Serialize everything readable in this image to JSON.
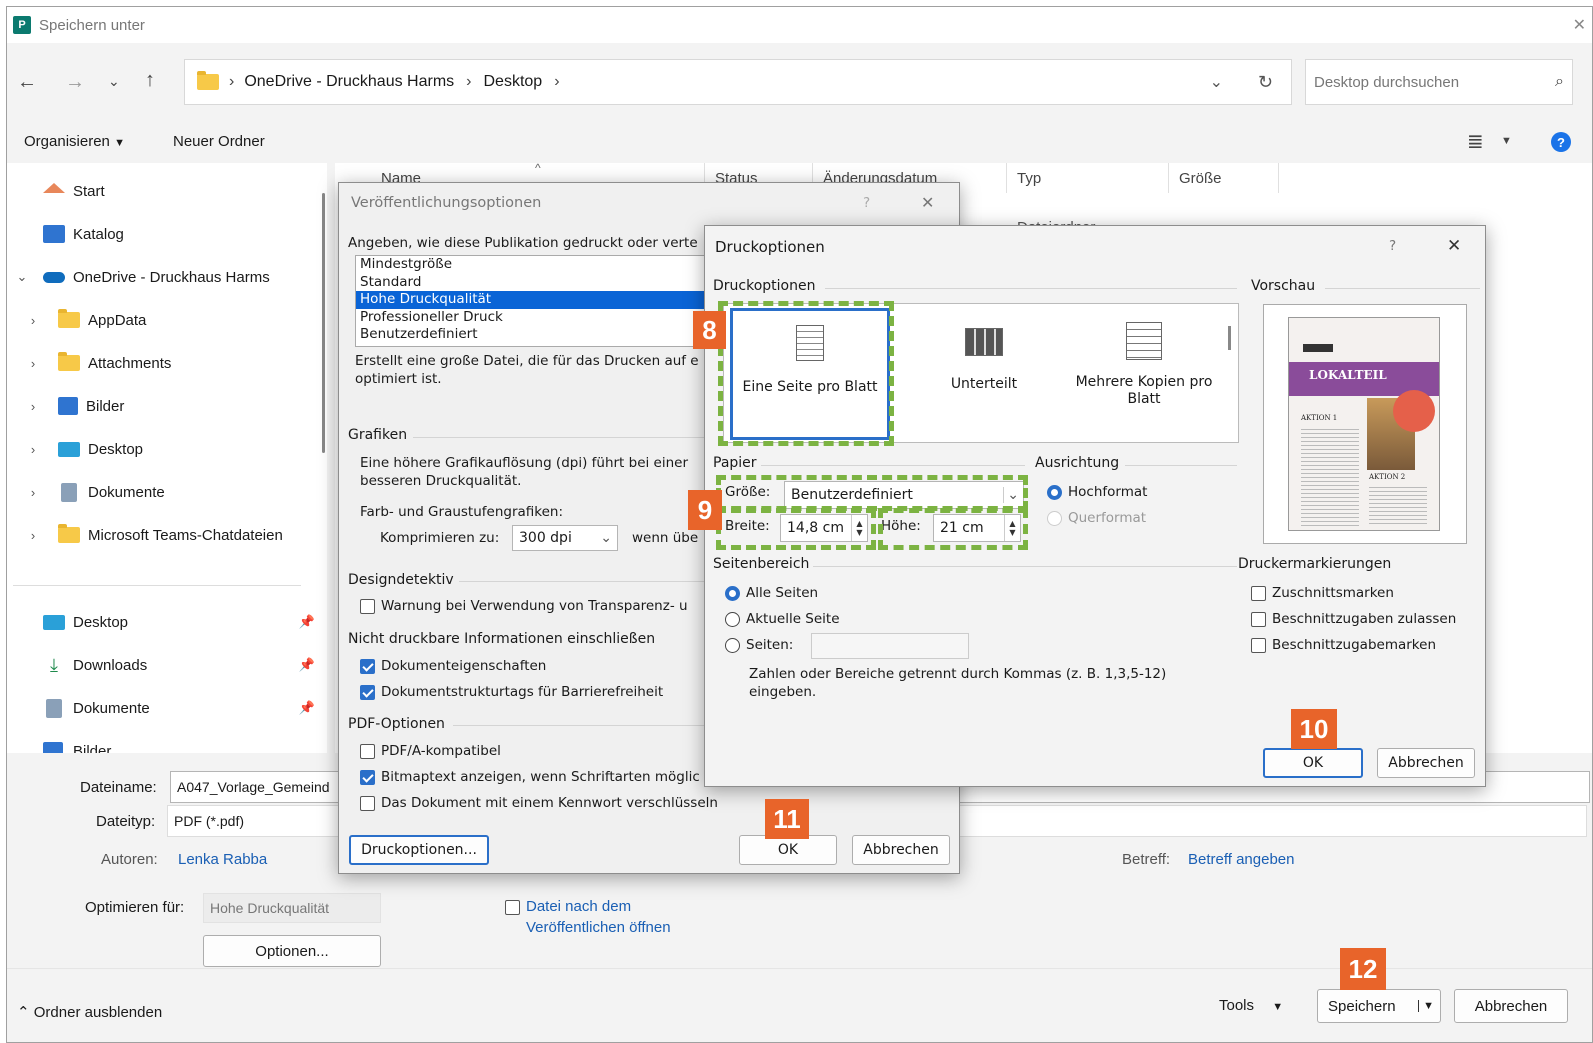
{
  "window": {
    "title": "Speichern unter"
  },
  "address": {
    "path": [
      "OneDrive - Druckhaus Harms",
      "Desktop"
    ],
    "search_placeholder": "Desktop durchsuchen"
  },
  "toolbar": {
    "organize": "Organisieren",
    "new_folder": "Neuer Ordner"
  },
  "nav": {
    "start": "Start",
    "katalog": "Katalog",
    "onedrive": "OneDrive - Druckhaus Harms",
    "folders": [
      "AppData",
      "Attachments",
      "Bilder",
      "Desktop",
      "Dokumente",
      "Microsoft Teams-Chatdateien"
    ],
    "quick": [
      "Desktop",
      "Downloads",
      "Dokumente",
      "Bilder"
    ]
  },
  "columns": {
    "name": "Name",
    "status": "Status",
    "date": "Änderungsdatum",
    "type": "Typ",
    "size": "Größe",
    "first_row_type": "Dateiordner"
  },
  "form": {
    "filename_label": "Dateiname:",
    "filename": "A047_Vorlage_Gemeind",
    "filetype_label": "Dateityp:",
    "filetype": "PDF (*.pdf)",
    "authors_label": "Autoren:",
    "authors": "Lenka Rabba",
    "subject_label": "Betreff:",
    "subject": "Betreff angeben",
    "optimize_label": "Optimieren für:",
    "optimize": "Hohe Druckqualität",
    "open_after_1": "Datei nach dem",
    "open_after_2": "Veröffentlichen öffnen",
    "options": "Optionen..."
  },
  "footer": {
    "hide_folders": "Ordner ausblenden",
    "tools": "Tools",
    "save": "Speichern",
    "cancel": "Abbrechen"
  },
  "publish": {
    "title": "Veröffentlichungsoptionen",
    "question": "?",
    "prompt": "Angeben, wie diese Publikation gedruckt oder verte",
    "list": [
      "Mindestgröße",
      "Standard",
      "Hohe Druckqualität",
      "Professioneller Druck",
      "Benutzerdefiniert"
    ],
    "desc1": "Erstellt eine große Datei, die für das Drucken auf e",
    "desc2": "optimiert ist.",
    "graphics": "Grafiken",
    "graphics_desc1": "Eine höhere Grafikauflösung (dpi) führt bei einer",
    "graphics_desc2": "besseren Druckqualität.",
    "color_label": "Farb- und Graustufengrafiken:",
    "compress_label": "Komprimieren zu:",
    "compress": "300 dpi",
    "when": "wenn übe",
    "design": "Designdetektiv",
    "warn": "Warnung bei Verwendung von Transparenz- u",
    "nonprint": "Nicht druckbare Informationen einschließen",
    "docprops": "Dokumenteigenschaften",
    "doctags": "Dokumentstrukturtags für Barrierefreiheit",
    "pdf": "PDF-Optionen",
    "pdfa": "PDF/A-kompatibel",
    "bitmap": "Bitmaptext anzeigen, wenn Schriftarten möglic",
    "encrypt": "Das Dokument mit einem Kennwort verschlüsseln",
    "printopts": "Druckoptionen...",
    "ok": "OK",
    "cancel": "Abbrechen"
  },
  "print": {
    "title": "Druckoptionen",
    "question": "?",
    "section": "Druckoptionen",
    "layouts": [
      "Eine Seite pro Blatt",
      "Unterteilt",
      "Mehrere Kopien pro Blatt"
    ],
    "preview": "Vorschau",
    "paper": "Papier",
    "size_label": "Größe:",
    "size": "Benutzerdefiniert",
    "width_label": "Breite:",
    "width": "14,8 cm",
    "height_label": "Höhe:",
    "height": "21 cm",
    "orientation": "Ausrichtung",
    "portrait": "Hochformat",
    "landscape": "Querformat",
    "range": "Seitenbereich",
    "all": "Alle Seiten",
    "current": "Aktuelle Seite",
    "pages": "Seiten:",
    "hint1": "Zahlen oder Bereiche getrennt durch Kommas (z. B. 1,3,5-12)",
    "hint2": "eingeben.",
    "marks": "Druckermarkierungen",
    "crop": "Zuschnittsmarken",
    "bleed": "Beschnittzugaben zulassen",
    "bleedmarks": "Beschnittzugabemarken",
    "ok": "OK",
    "cancel": "Abbrechen",
    "thumb_title": "LOKALTEIL",
    "thumb_a1": "AKTION 1",
    "thumb_a2": "AKTION 2"
  },
  "badges": [
    "8",
    "9",
    "10",
    "11",
    "12"
  ],
  "colors": {
    "accent": "#2a6fc9",
    "badge": "#e8642a",
    "dash": "#7cb342",
    "thumb_header": "#8a4c9a",
    "thumb_circle": "#e5604a"
  }
}
